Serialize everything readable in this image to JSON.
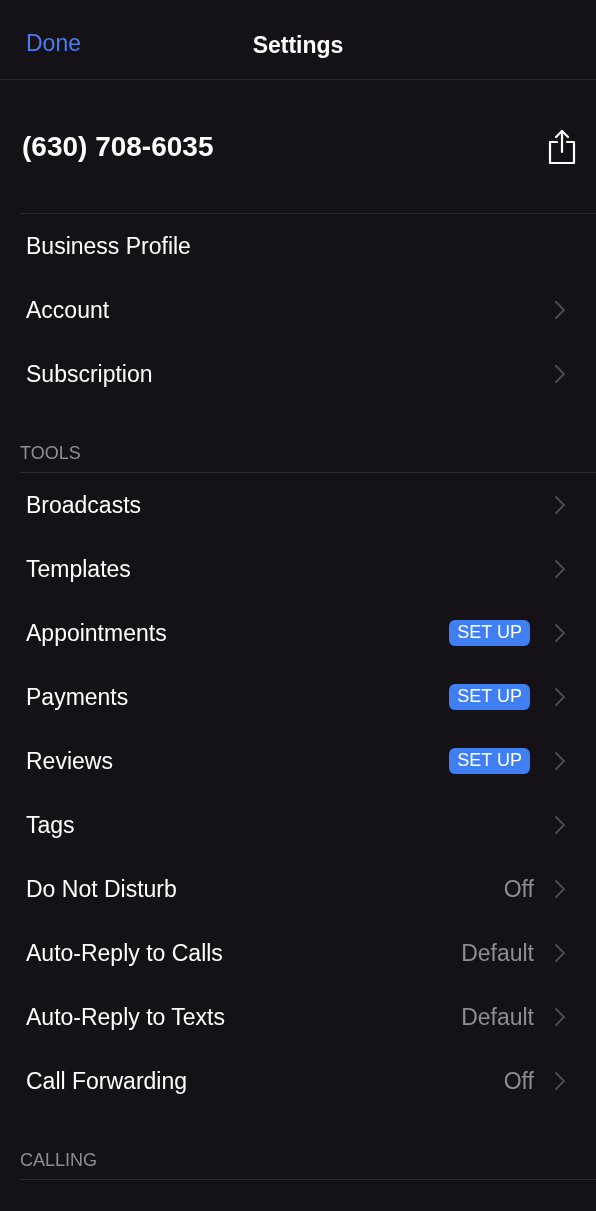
{
  "nav": {
    "left_button": "Done",
    "title": "Settings"
  },
  "phone": {
    "number": "(630) 708-6035"
  },
  "sections": [
    {
      "items": [
        {
          "label": "Business Profile",
          "chevron": false
        },
        {
          "label": "Account",
          "chevron": true
        },
        {
          "label": "Subscription",
          "chevron": true
        }
      ]
    },
    {
      "header": "TOOLS",
      "items": [
        {
          "label": "Broadcasts",
          "chevron": true
        },
        {
          "label": "Templates",
          "chevron": true
        },
        {
          "label": "Appointments",
          "badge": "SET UP",
          "chevron": true
        },
        {
          "label": "Payments",
          "badge": "SET UP",
          "chevron": true
        },
        {
          "label": "Reviews",
          "badge": "SET UP",
          "chevron": true
        },
        {
          "label": "Tags",
          "chevron": true
        },
        {
          "label": "Do Not Disturb",
          "value": "Off",
          "chevron": true
        },
        {
          "label": "Auto-Reply to Calls",
          "value": "Default",
          "chevron": true
        },
        {
          "label": "Auto-Reply to Texts",
          "value": "Default",
          "chevron": true
        },
        {
          "label": "Call Forwarding",
          "value": "Off",
          "chevron": true
        }
      ]
    },
    {
      "header": "CALLING"
    }
  ]
}
